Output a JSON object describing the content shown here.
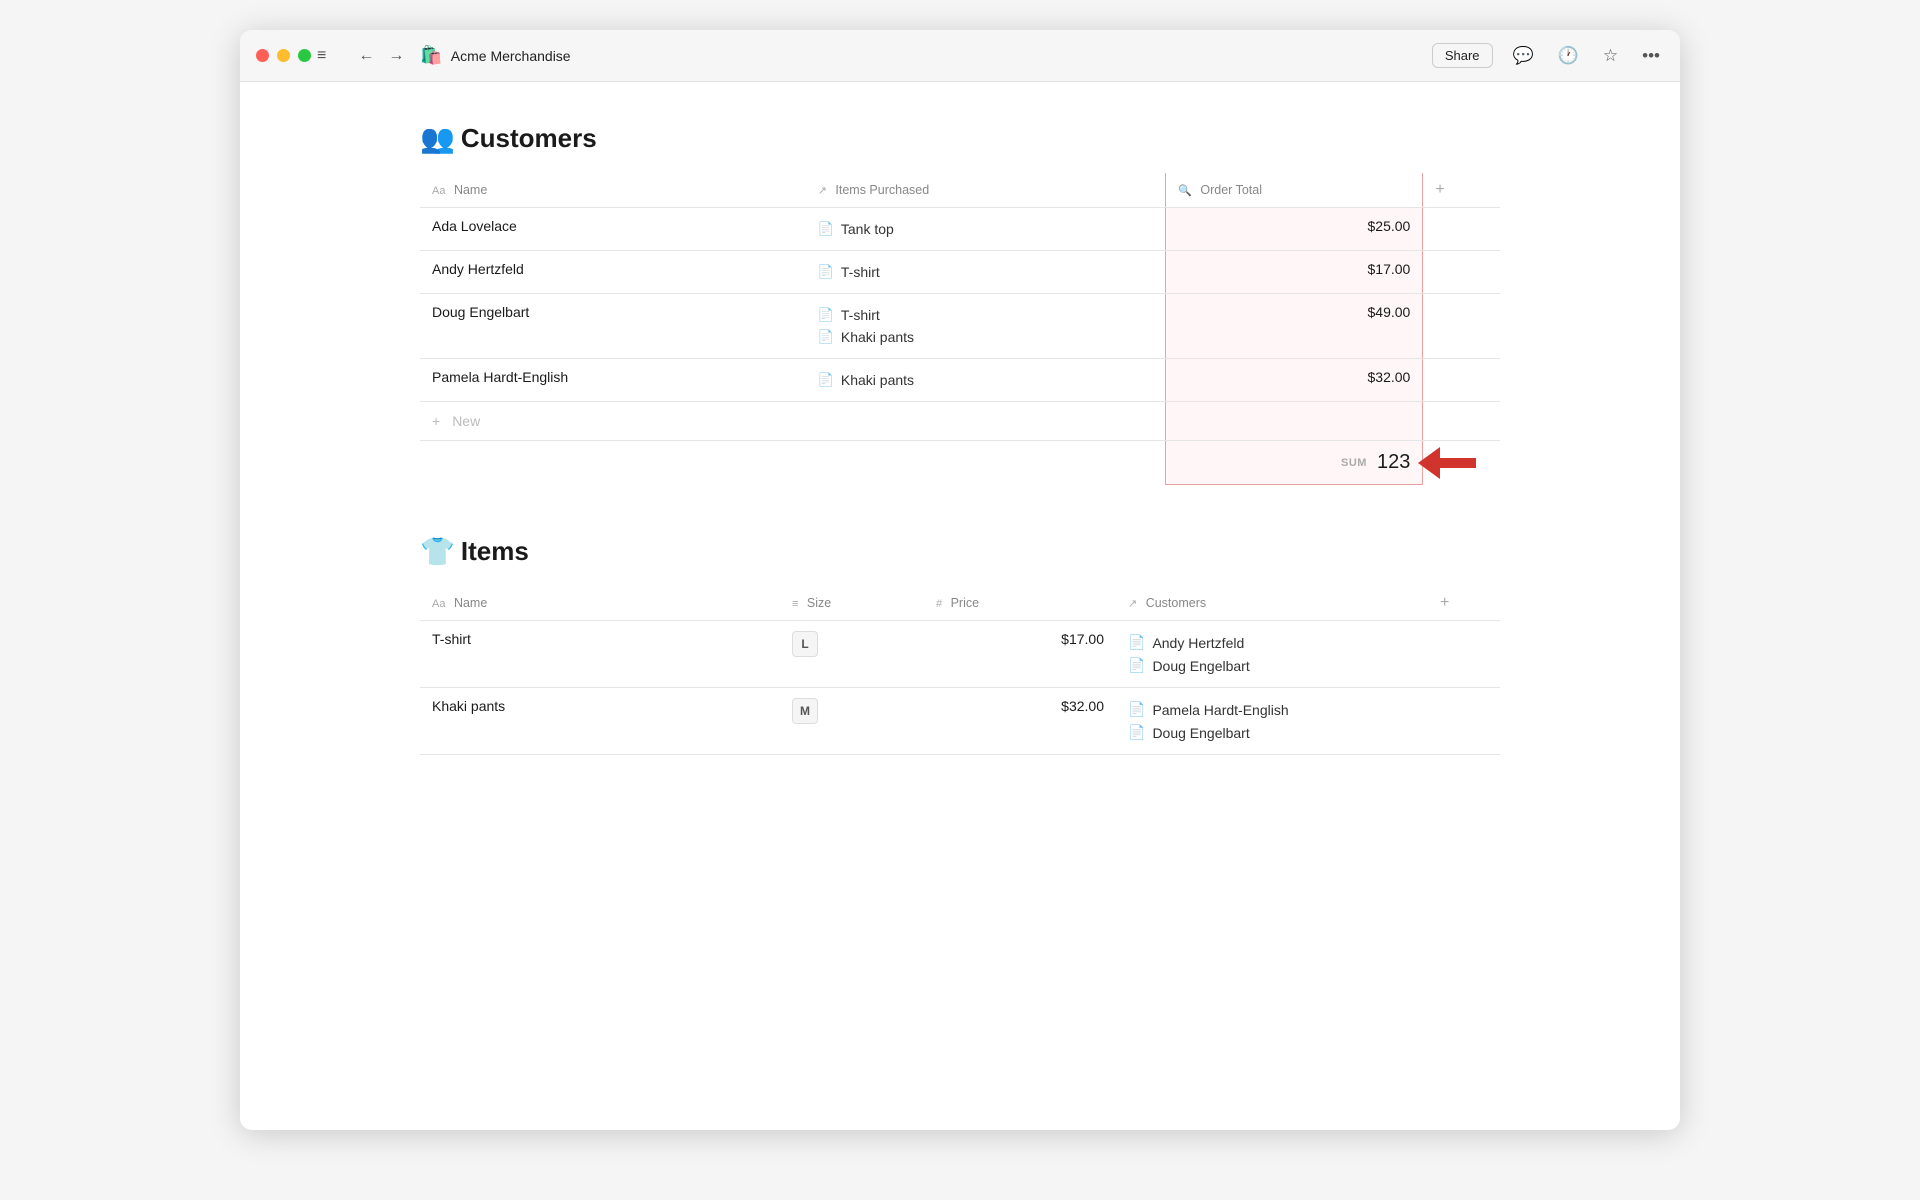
{
  "window": {
    "title": "Acme Merchandise",
    "app_icon": "🛍️"
  },
  "titlebar": {
    "share_label": "Share",
    "hamburger_icon": "≡",
    "back_icon": "←",
    "forward_icon": "→"
  },
  "customers_section": {
    "heading": "Customers",
    "heading_emoji": "👥",
    "columns": [
      {
        "icon": "Aa",
        "label": "Name"
      },
      {
        "icon": "↗",
        "label": "Items Purchased"
      },
      {
        "icon": "🔍",
        "label": "Order Total"
      },
      {
        "icon": "+",
        "label": ""
      }
    ],
    "rows": [
      {
        "name": "Ada Lovelace",
        "items": [
          "Tank top"
        ],
        "order_total": "$25.00"
      },
      {
        "name": "Andy Hertzfeld",
        "items": [
          "T-shirt"
        ],
        "order_total": "$17.00"
      },
      {
        "name": "Doug Engelbart",
        "items": [
          "T-shirt",
          "Khaki pants"
        ],
        "order_total": "$49.00"
      },
      {
        "name": "Pamela Hardt-English",
        "items": [
          "Khaki pants"
        ],
        "order_total": "$32.00"
      }
    ],
    "new_row_label": "New",
    "sum_label": "SUM",
    "sum_value": "123"
  },
  "items_section": {
    "heading": "Items",
    "heading_emoji": "👕",
    "columns": [
      {
        "icon": "Aa",
        "label": "Name"
      },
      {
        "icon": "≡",
        "label": "Size"
      },
      {
        "icon": "#",
        "label": "Price"
      },
      {
        "icon": "↗",
        "label": "Customers"
      },
      {
        "icon": "+",
        "label": ""
      }
    ],
    "rows": [
      {
        "name": "T-shirt",
        "size": "L",
        "price": "$17.00",
        "customers": [
          "Andy Hertzfeld",
          "Doug Engelbart"
        ]
      },
      {
        "name": "Khaki pants",
        "size": "M",
        "price": "$32.00",
        "customers": [
          "Pamela Hardt-English",
          "Doug Engelbart"
        ]
      }
    ]
  }
}
